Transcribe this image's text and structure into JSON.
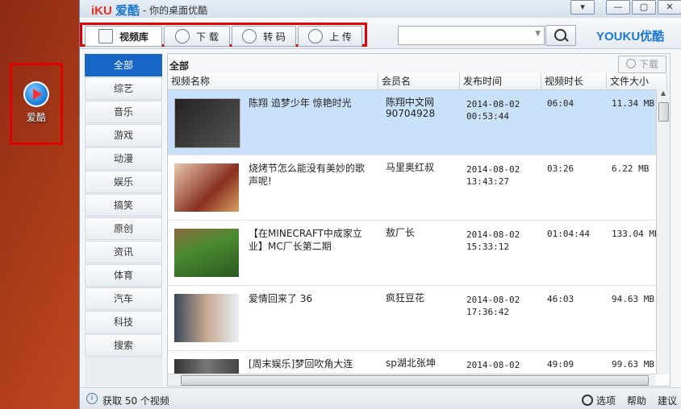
{
  "desktop": {
    "icon_label": "爱酷"
  },
  "window": {
    "logo_a": "iKU",
    "logo_b": "爱酷",
    "title": "- 你的桌面优酷",
    "btn_min": "▾",
    "btn_restore": "—",
    "btn_max": "▢",
    "btn_close": "✕"
  },
  "toolbar": {
    "tabs": [
      {
        "label": "视频库"
      },
      {
        "label": "下 载"
      },
      {
        "label": "转 码"
      },
      {
        "label": "上 传"
      }
    ],
    "search_placeholder": "",
    "brand_a": "YOUKU",
    "brand_b": "优酷"
  },
  "sidebar": {
    "items": [
      "全部",
      "综艺",
      "音乐",
      "游戏",
      "动漫",
      "娱乐",
      "搞笑",
      "原创",
      "资讯",
      "体育",
      "汽车",
      "科技",
      "搜索"
    ]
  },
  "main": {
    "section_title": "全部",
    "download_label": "下载",
    "columns": [
      "视频名称",
      "会员名",
      "发布时间",
      "视频时长",
      "文件大小"
    ],
    "rows": [
      {
        "title": "陈翔 追梦少年 惊艳时光",
        "user": "陈翔中文网\n90704928",
        "date": "2014-08-02\n00:53:44",
        "duration": "06:04",
        "size": "11.34 MB"
      },
      {
        "title": "烧烤节怎么能没有美妙的歌声呢!",
        "user": "马里奥红叔",
        "date": "2014-08-02\n13:43:27",
        "duration": "03:26",
        "size": "6.22 MB"
      },
      {
        "title": "【在MINECRAFT中成家立业】MC厂长第二期",
        "user": "敖厂长",
        "date": "2014-08-02\n15:33:12",
        "duration": "01:04:44",
        "size": "133.04 MB"
      },
      {
        "title": "爱情回来了 36",
        "user": "疯狂豆花",
        "date": "2014-08-02\n17:36:42",
        "duration": "46:03",
        "size": "94.63 MB"
      },
      {
        "title": "[周末娱乐]梦回吹角大连",
        "user": "sp湖北张坤",
        "date": "2014-08-02",
        "duration": "49:09",
        "size": "99.63 MB"
      }
    ]
  },
  "status": {
    "text": "获取 50 个视频",
    "options": "选项",
    "help": "帮助",
    "suggest": "建议"
  },
  "colors": {
    "accent": "#1766c5",
    "highlight_box": "#e00000",
    "selected_row": "#c9e1fb"
  }
}
